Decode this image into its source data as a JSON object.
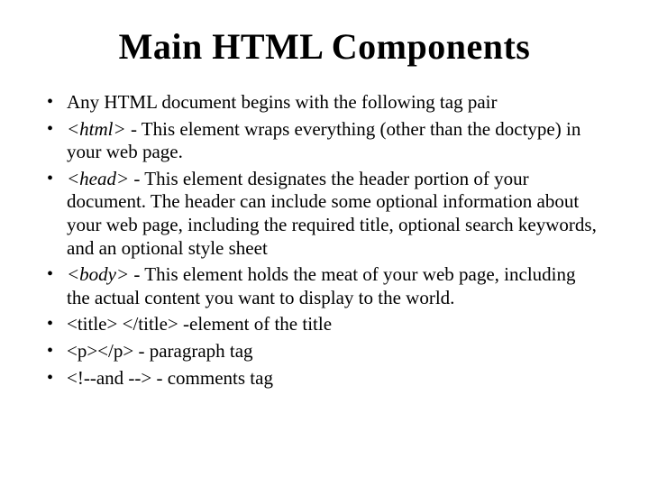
{
  "title": "Main HTML Components",
  "items": [
    {
      "pre": "",
      "tag": "",
      "post": "Any HTML document begins with the following tag pair"
    },
    {
      "pre": "",
      "tag": "<html>",
      "post": " - This element wraps everything (other than the doctype) in your web page."
    },
    {
      "pre": "",
      "tag": "<head>",
      "post": " - This element designates the header portion of your document. The header can include some optional information about your web page, including the required title, optional search keywords, and an optional style sheet"
    },
    {
      "pre": "",
      "tag": "<body>",
      "post": " - This element holds the meat of your web page, including the actual content you want to display to the world."
    },
    {
      "pre": "<title> </title> -element of the title",
      "tag": "",
      "post": ""
    },
    {
      "pre": "<p></p> - paragraph tag",
      "tag": "",
      "post": ""
    },
    {
      "pre": "<!--and --> - comments tag",
      "tag": "",
      "post": ""
    }
  ]
}
